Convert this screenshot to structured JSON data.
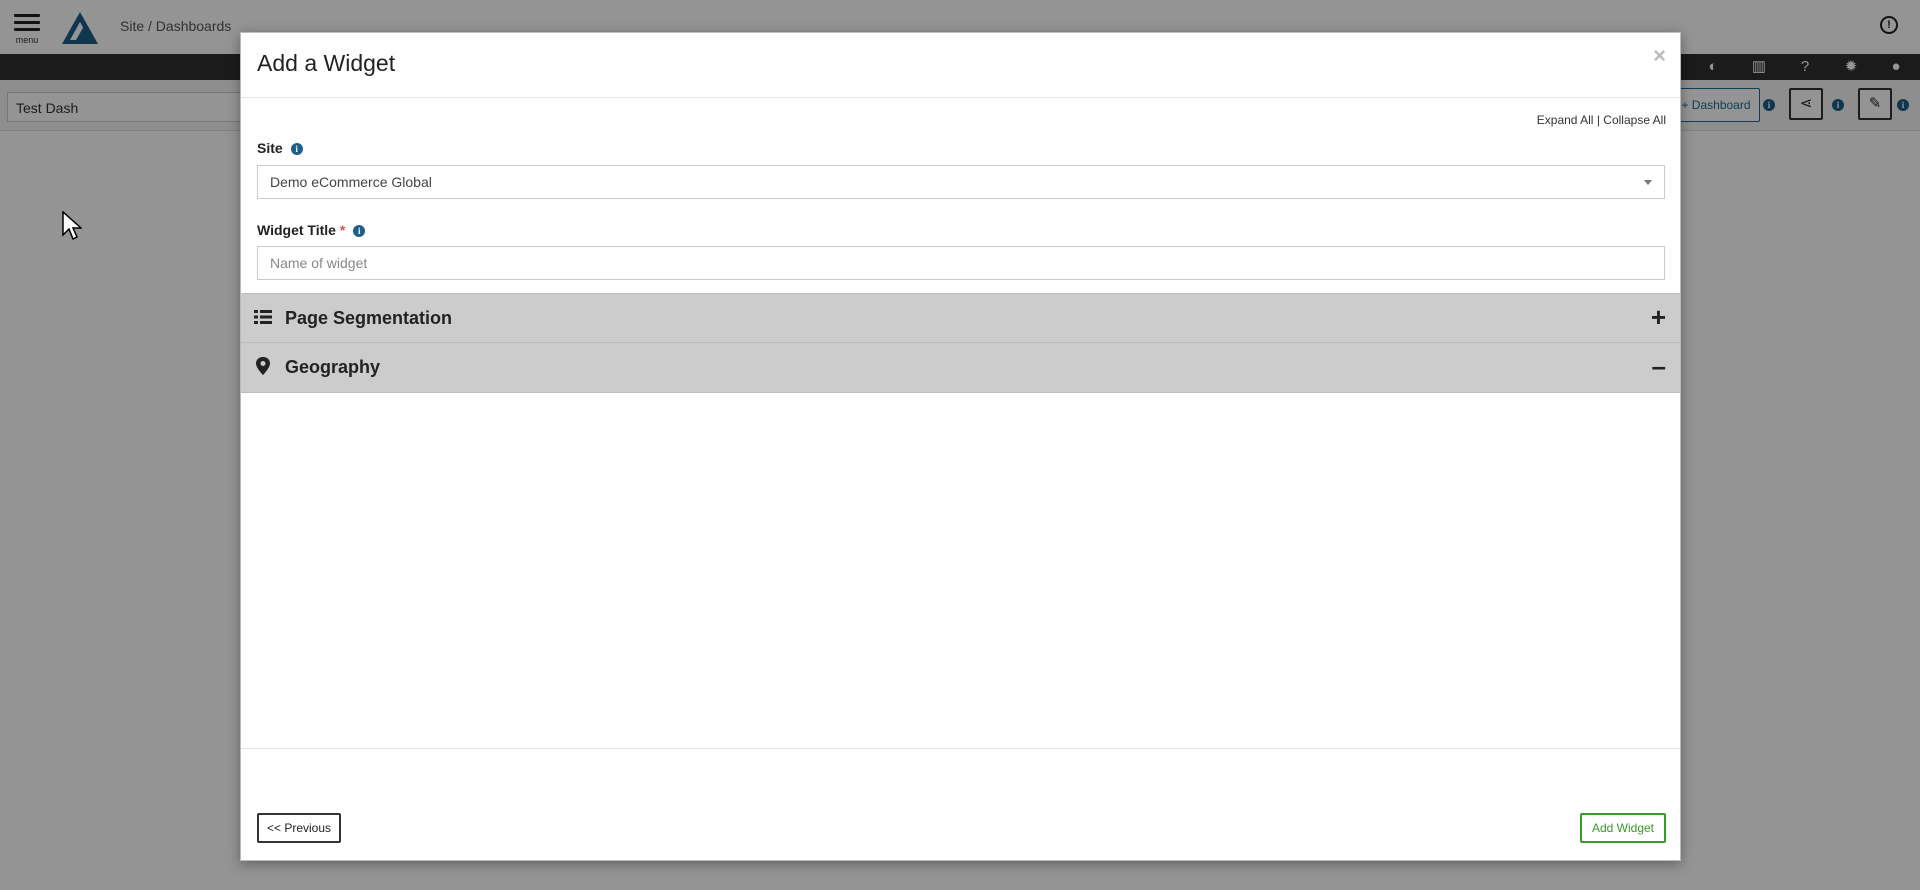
{
  "app": {
    "menu_label": "menu",
    "breadcrumb": "Site / Dashboards",
    "dashboard_name": "Test Dash",
    "add_dashboard_label": "+ Dashboard",
    "icons": [
      "contrast-icon",
      "columns-icon",
      "help-icon",
      "settings-icon",
      "user-icon",
      "share-icon",
      "wrench-icon",
      "alert-icon"
    ]
  },
  "modal": {
    "title": "Add a Widget",
    "close_label": "×",
    "expand_all": "Expand All",
    "separator": "|",
    "collapse_all": "Collapse All",
    "site_label": "Site",
    "site_value": "Demo eCommerce Global",
    "widget_title_label": "Widget Title",
    "required_mark": "*",
    "widget_title_placeholder": "Name of widget",
    "widget_title_value": "",
    "sections": [
      {
        "title": "Page Segmentation",
        "icon": "list-icon",
        "toggle": "+",
        "expanded": false
      },
      {
        "title": "Geography",
        "icon": "map-marker-icon",
        "toggle": "–",
        "expanded": true
      }
    ],
    "previous_label": "<< Previous",
    "add_widget_label": "Add Widget"
  },
  "colors": {
    "accent_blue": "#1c6b93",
    "add_green": "#3a9a28",
    "accordion_bg": "#cccccc",
    "required_red": "#d9534f"
  }
}
